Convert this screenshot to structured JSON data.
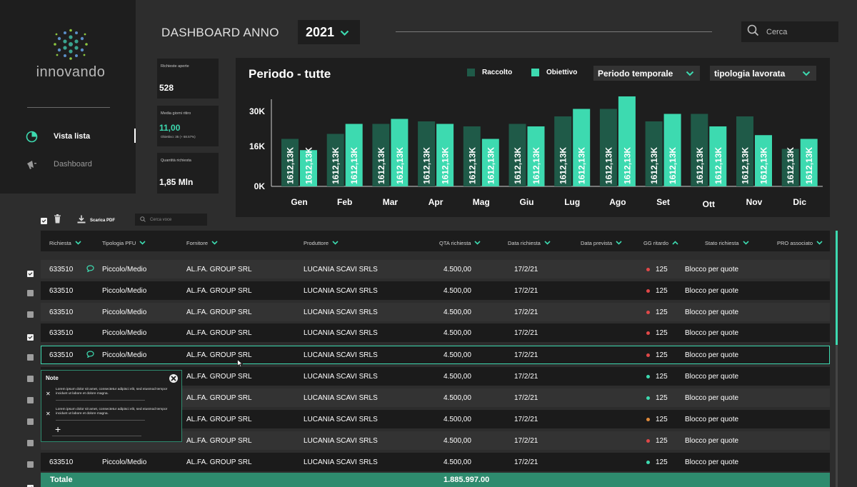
{
  "brand": {
    "name": "innovando",
    "accent": "#3ddab0",
    "accent_dark": "#1f5a48"
  },
  "sidebar": {
    "items": [
      {
        "label": "Vista lista",
        "icon": "pie-chart-icon",
        "active": true
      },
      {
        "label": "Dashboard",
        "icon": "megaphone-icon",
        "active": false
      }
    ]
  },
  "header": {
    "title": "DASHBOARD ANNO",
    "year": "2021",
    "search_placeholder": "Cerca"
  },
  "kpis": [
    {
      "label": "Richieste aperte",
      "value": "528"
    },
    {
      "label": "Media giorni ritiro",
      "value": "11,00",
      "sub": "Obiettivo: 35 (+ 68.57%)"
    },
    {
      "label": "Quantità richiesta",
      "value": "1,85 Mln"
    }
  ],
  "chart_panel": {
    "title": "Periodo - tutte",
    "legend": [
      {
        "label": "Raccolto",
        "color": "#1f5a48"
      },
      {
        "label": "Obiettivo",
        "color": "#3ddab0"
      }
    ],
    "filters": [
      "Periodo temporale",
      "tipologia lavorata"
    ]
  },
  "chart_data": {
    "type": "bar",
    "categories": [
      "Gen",
      "Feb",
      "Mar",
      "Apr",
      "Mag",
      "Giu",
      "Lug",
      "Ago",
      "Set",
      "Ott",
      "Nov",
      "Dic"
    ],
    "series": [
      {
        "name": "Raccolto",
        "values": [
          19,
          21,
          25,
          26,
          24,
          25,
          28,
          31,
          26,
          29,
          28,
          15
        ],
        "labels": [
          "1612,13K",
          "1612,13K",
          "1612,13K",
          "1612,13K",
          "1612,13K",
          "1612,13K",
          "1612,13K",
          "1612,13K",
          "1612,13K",
          "1612,13K",
          "1612,13K",
          "1612,13K"
        ],
        "color": "#1f5a48"
      },
      {
        "name": "Obiettivo",
        "values": [
          14.5,
          25,
          27,
          25,
          19,
          24,
          31,
          36,
          29,
          24,
          20.5,
          19
        ],
        "labels": [
          "1612,13K",
          "1612,13K",
          "1612,13K",
          "1612,13K",
          "1612,13K",
          "1612,13K",
          "1612,13K",
          "1612,13K",
          "1612,13K",
          "1612,13K",
          "1612,13K",
          "1612,13K"
        ],
        "color": "#3ddab0"
      }
    ],
    "yticks": [
      "0K",
      "16K",
      "30K"
    ],
    "ylim": [
      0,
      36
    ],
    "grid": false
  },
  "toolbar": {
    "download_label": "Scarica PDF",
    "search_placeholder": "Cerca voce"
  },
  "table": {
    "columns": [
      {
        "label": "Richiesta",
        "sort": "down"
      },
      {
        "label": "Tipologia PFU",
        "sort": "down"
      },
      {
        "label": "Fornitore",
        "sort": "down"
      },
      {
        "label": "Produttore",
        "sort": "down"
      },
      {
        "label": "QTA richiesta",
        "sort": "down"
      },
      {
        "label": "Data richiesta",
        "sort": "down"
      },
      {
        "label": "Data prevista",
        "sort": "down"
      },
      {
        "label": "GG ritardo",
        "sort": "up"
      },
      {
        "label": "Stato richiesta",
        "sort": "down"
      },
      {
        "label": "PRO associato",
        "sort": "down"
      }
    ],
    "rows": [
      {
        "checked": true,
        "richiesta": "633510",
        "comment": true,
        "tipologia": "Piccolo/Medio",
        "fornitore": "AL.FA. GROUP SRL",
        "produttore": "LUCANIA SCAVI SRLS",
        "qta": "4.500,00",
        "data_richiesta": "17/2/21",
        "status_color": "#e04848",
        "gg": "125",
        "stato": "Blocco per quote"
      },
      {
        "checked": false,
        "richiesta": "633510",
        "comment": false,
        "tipologia": "Piccolo/Medio",
        "fornitore": "AL.FA. GROUP SRL",
        "produttore": "LUCANIA SCAVI SRLS",
        "qta": "4.500,00",
        "data_richiesta": "17/2/21",
        "status_color": "#e04848",
        "gg": "125",
        "stato": "Blocco per quote"
      },
      {
        "checked": false,
        "richiesta": "633510",
        "comment": false,
        "tipologia": "Piccolo/Medio",
        "fornitore": "AL.FA. GROUP SRL",
        "produttore": "LUCANIA SCAVI SRLS",
        "qta": "4.500,00",
        "data_richiesta": "17/2/21",
        "status_color": "#e04848",
        "gg": "125",
        "stato": "Blocco per quote"
      },
      {
        "checked": true,
        "richiesta": "633510",
        "comment": false,
        "tipologia": "Piccolo/Medio",
        "fornitore": "AL.FA. GROUP SRL",
        "produttore": "LUCANIA SCAVI SRLS",
        "qta": "4.500,00",
        "data_richiesta": "17/2/21",
        "status_color": "#e04848",
        "gg": "125",
        "stato": "Blocco per quote"
      },
      {
        "checked": false,
        "richiesta": "633510",
        "comment": true,
        "tipologia": "Piccolo/Medio",
        "fornitore": "AL.FA. GROUP SRL",
        "produttore": "LUCANIA SCAVI SRLS",
        "qta": "4.500,00",
        "data_richiesta": "17/2/21",
        "status_color": "#e04848",
        "gg": "125",
        "stato": "Blocco per quote"
      },
      {
        "checked": false,
        "richiesta": "",
        "comment": false,
        "tipologia": "",
        "fornitore": "AL.FA. GROUP SRL",
        "produttore": "LUCANIA SCAVI SRLS",
        "qta": "4.500,00",
        "data_richiesta": "17/2/21",
        "status_color": "#3ddab0",
        "gg": "125",
        "stato": "Blocco per quote"
      },
      {
        "checked": false,
        "richiesta": "",
        "comment": false,
        "tipologia": "",
        "fornitore": "AL.FA. GROUP SRL",
        "produttore": "LUCANIA SCAVI SRLS",
        "qta": "4.500,00",
        "data_richiesta": "17/2/21",
        "status_color": "#3ddab0",
        "gg": "125",
        "stato": "Blocco per quote"
      },
      {
        "checked": false,
        "richiesta": "",
        "comment": false,
        "tipologia": "",
        "fornitore": "AL.FA. GROUP SRL",
        "produttore": "LUCANIA SCAVI SRLS",
        "qta": "4.500,00",
        "data_richiesta": "17/2/21",
        "status_color": "#e08a3a",
        "gg": "125",
        "stato": "Blocco per quote"
      },
      {
        "checked": false,
        "richiesta": "",
        "comment": false,
        "tipologia": "",
        "fornitore": "AL.FA. GROUP SRL",
        "produttore": "LUCANIA SCAVI SRLS",
        "qta": "4.500,00",
        "data_richiesta": "17/2/21",
        "status_color": "#e04848",
        "gg": "125",
        "stato": "Blocco per quote"
      },
      {
        "checked": false,
        "richiesta": "633510",
        "comment": false,
        "tipologia": "Piccolo/Medio",
        "fornitore": "AL.FA. GROUP SRL",
        "produttore": "LUCANIA SCAVI SRLS",
        "qta": "4.500,00",
        "data_richiesta": "17/2/21",
        "status_color": "#3ddab0",
        "gg": "125",
        "stato": "Blocco per quote"
      }
    ],
    "total": {
      "label": "Totale",
      "value": "1.885.997.00"
    }
  },
  "note_popup": {
    "title": "Note",
    "items": [
      "Lorem ipsum dolor sit amet, consectetur adipisci elit, sed eiusmod tempor incidunt ut labore et dolore magna.",
      "Lorem ipsum dolor sit amet, consectetur adipisci elit, sed eiusmod tempor incidunt ut labore et dolore magna."
    ],
    "add_label": "+"
  }
}
